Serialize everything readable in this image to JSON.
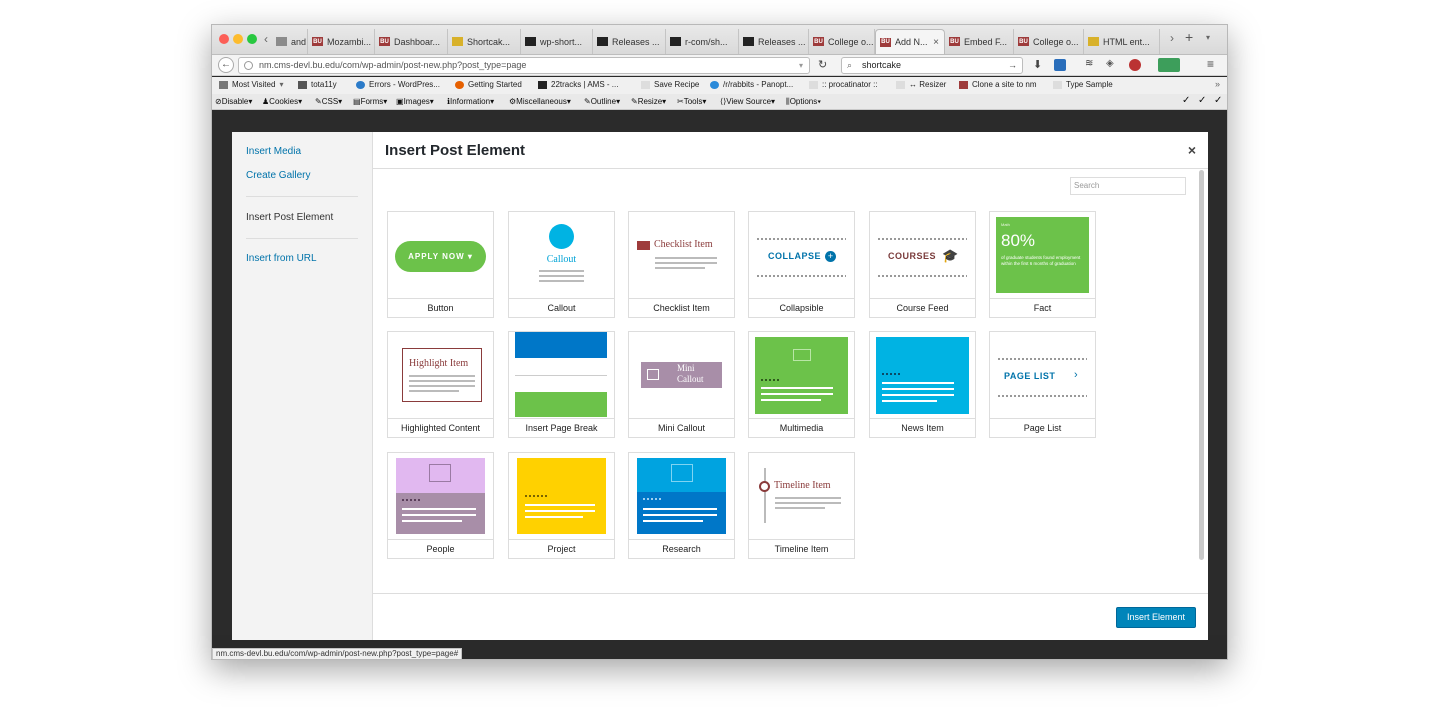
{
  "browser": {
    "tabs": [
      {
        "label": "and ...",
        "fav": "",
        "color": "#8b8b8b"
      },
      {
        "label": "Mozambi...",
        "fav": "BU",
        "color": "#9e3b3b"
      },
      {
        "label": "Dashboar...",
        "fav": "BU",
        "color": "#9e3b3b"
      },
      {
        "label": "Shortcak...",
        "fav": "",
        "color": "#d8b12a"
      },
      {
        "label": "wp-short...",
        "fav": "",
        "color": "#222222"
      },
      {
        "label": "Releases ...",
        "fav": "",
        "color": "#222222"
      },
      {
        "label": "r-com/sh...",
        "fav": "",
        "color": "#222222"
      },
      {
        "label": "Releases ...",
        "fav": "",
        "color": "#222222"
      },
      {
        "label": "College o...",
        "fav": "BU",
        "color": "#9e3b3b"
      },
      {
        "label": "Add N...",
        "fav": "BU",
        "color": "#9e3b3b"
      },
      {
        "label": "Embed F...",
        "fav": "BU",
        "color": "#9e3b3b"
      },
      {
        "label": "College o...",
        "fav": "BU",
        "color": "#9e3b3b"
      },
      {
        "label": "HTML ent...",
        "fav": "",
        "color": "#d8b12a"
      }
    ],
    "tab_close": "×",
    "new_tab": "+",
    "url": "nm.cms-devl.bu.edu/com/wp-admin/post-new.php?post_type=page",
    "search_value": "shortcake",
    "bookmarks": [
      "Most Visited",
      "tota11y",
      "Errors - WordPres...",
      "Getting Started",
      "22tracks | AMS - ...",
      "Save Recipe",
      "/r/rabbits - Panopt...",
      ":: procatinator ::",
      "↔ Resizer",
      "Clone a site to nm",
      "Type Sample"
    ],
    "devtools": [
      "Disable",
      "Cookies",
      "CSS",
      "Forms",
      "Images",
      "Information",
      "Miscellaneous",
      "Outline",
      "Resize",
      "Tools",
      "View Source",
      "Options"
    ],
    "status_url": "nm.cms-devl.bu.edu/com/wp-admin/post-new.php?post_type=page#"
  },
  "modal": {
    "title": "Insert Post Element",
    "close": "×",
    "search_placeholder": "Search",
    "insert_button": "Insert Element",
    "sidebar": {
      "insert_media": "Insert Media",
      "create_gallery": "Create Gallery",
      "insert_post_element": "Insert Post Element",
      "insert_from_url": "Insert from URL"
    },
    "elements": [
      {
        "label": "Button",
        "thumb_text": "APPLY NOW ▾"
      },
      {
        "label": "Callout",
        "thumb_text": "Callout"
      },
      {
        "label": "Checklist Item",
        "thumb_text": "Checklist Item"
      },
      {
        "label": "Collapsible",
        "thumb_text": "COLLAPSE"
      },
      {
        "label": "Course Feed",
        "thumb_text": "COURSES"
      },
      {
        "label": "Fact",
        "thumb_text": "80%",
        "thumb_text2": "of graduate students found employment within the first 6 months of graduation",
        "thumb_text3": "Math"
      },
      {
        "label": "Highlighted Content",
        "thumb_text": "Highlight Item"
      },
      {
        "label": "Insert Page Break",
        "thumb_text": ""
      },
      {
        "label": "Mini Callout",
        "thumb_text": "Mini Callout"
      },
      {
        "label": "Multimedia",
        "thumb_text": ""
      },
      {
        "label": "News Item",
        "thumb_text": ""
      },
      {
        "label": "Page List",
        "thumb_text": "PAGE LIST"
      },
      {
        "label": "People",
        "thumb_text": ""
      },
      {
        "label": "Project",
        "thumb_text": ""
      },
      {
        "label": "Research",
        "thumb_text": ""
      },
      {
        "label": "Timeline Item",
        "thumb_text": "Timeline Item"
      }
    ]
  },
  "colors": {
    "wp_blue": "#0073aa",
    "button_green": "#6cc24a",
    "fact_green": "#6cc24a",
    "callout_cyan": "#00b3e3",
    "break_blue": "#0077c8",
    "project_yellow": "#ffd100",
    "people_purple": "#e1b8f0",
    "bu_red": "#9e3b3b"
  }
}
